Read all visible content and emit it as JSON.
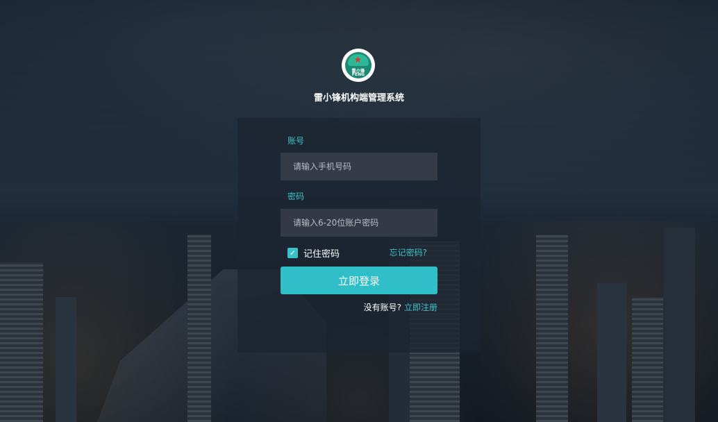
{
  "app": {
    "title": "雷小锋机构端管理系统",
    "logo_text_top": "雷小锋",
    "logo_text_bottom": "FENG"
  },
  "form": {
    "account_label": "账号",
    "account_placeholder": "请输入手机号码",
    "password_label": "密码",
    "password_placeholder": "请输入6-20位账户密码",
    "remember_label": "记住密码",
    "remember_checked": true,
    "forgot_label": "忘记密码?",
    "login_button": "立即登录",
    "register_prompt": "没有账号?",
    "register_link": "立即注册"
  },
  "colors": {
    "accent": "#30bfc8",
    "panel_bg": "rgba(28,36,48,0.72)",
    "logo_green": "#1b8a74"
  }
}
